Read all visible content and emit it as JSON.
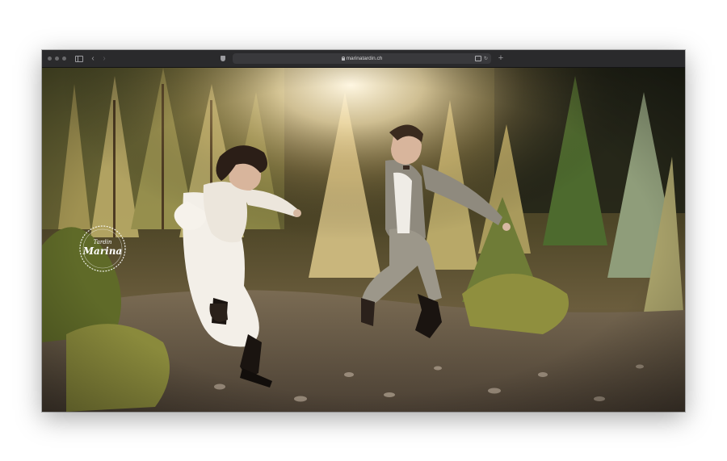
{
  "browser": {
    "url": "marinatardin.ch",
    "back_label": "‹",
    "forward_label": "›",
    "new_tab_label": "+",
    "reload_label": "↻"
  },
  "page": {
    "logo_text": "Marina",
    "logo_subtext": "Tardin"
  },
  "colors": {
    "toolbar": "#2a2a2c",
    "address_bar": "#39393c",
    "photo_warm": "#c9a770"
  }
}
